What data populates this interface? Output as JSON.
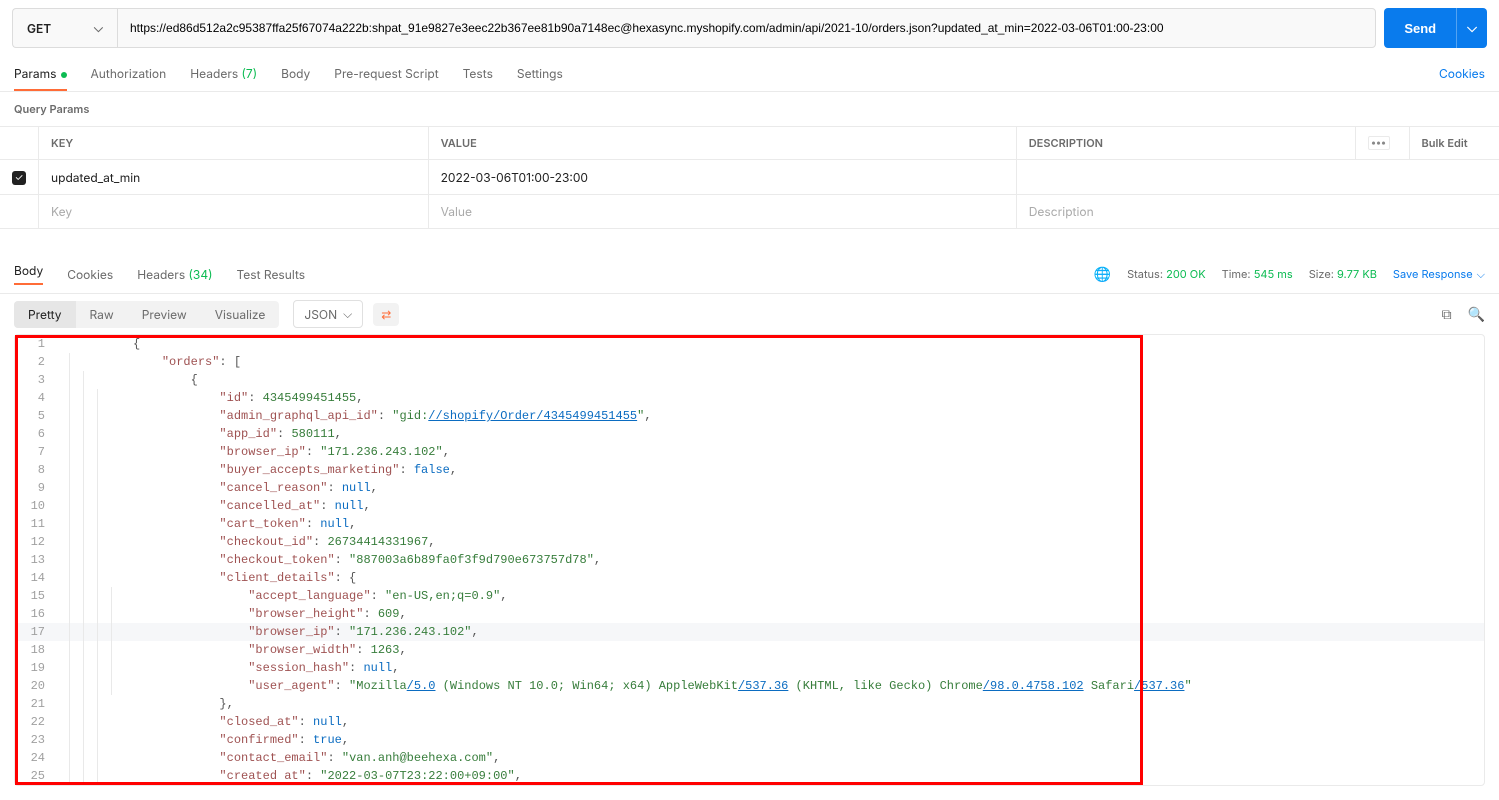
{
  "request": {
    "method": "GET",
    "url": "https://ed86d512a2c95387ffa25f67074a222b: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@hexasync.myshopify.com/admin/api/2021-10/orders.json?updated_at_min=2022-03-06T01:00-23:00",
    "send_label": "Send"
  },
  "req_tabs": {
    "params": "Params",
    "auth": "Authorization",
    "headers": "Headers",
    "headers_count": "(7)",
    "body": "Body",
    "prerequest": "Pre-request Script",
    "tests": "Tests",
    "settings": "Settings",
    "cookies": "Cookies"
  },
  "query_params": {
    "title": "Query Params",
    "headers": {
      "key": "KEY",
      "value": "VALUE",
      "description": "DESCRIPTION",
      "bulk": "Bulk Edit"
    },
    "row1": {
      "key": "updated_at_min",
      "value": "2022-03-06T01:00-23:00"
    },
    "row2": {
      "key_ph": "Key",
      "value_ph": "Value",
      "desc_ph": "Description"
    }
  },
  "resp_tabs": {
    "body": "Body",
    "cookies": "Cookies",
    "headers": "Headers",
    "headers_count": "(34)",
    "tests": "Test Results"
  },
  "status": {
    "status_lbl": "Status:",
    "status_val": "200 OK",
    "time_lbl": "Time:",
    "time_val": "545 ms",
    "size_lbl": "Size:",
    "size_val": "9.77 KB",
    "save": "Save Response"
  },
  "viewer": {
    "pretty": "Pretty",
    "raw": "Raw",
    "preview": "Preview",
    "visualize": "Visualize",
    "json": "JSON"
  },
  "json_body": {
    "id": "4345499451455",
    "admin_graphql_api_id_link": "//shopify/Order/4345499451455",
    "app_id": "580111",
    "browser_ip": "171.236.243.102",
    "buyer_accepts_marketing": "false",
    "cancel_reason": "null",
    "cancelled_at": "null",
    "cart_token": "null",
    "checkout_id": "26734414331967",
    "checkout_token": "887003a6b89fa0f3f9d790e673757d78",
    "accept_language": "en-US,en;q=0.9",
    "browser_height": "609",
    "client_browser_ip": "171.236.243.102",
    "browser_width": "1263",
    "session_hash": "null",
    "ua_p1": "Mozilla",
    "ua_l1": "/5.0",
    "ua_p2": " (Windows NT 10.0; Win64; x64) AppleWebKit",
    "ua_l2": "/537.36",
    "ua_p3": " (KHTML, like Gecko) Chrome",
    "ua_l3": "/98.0.4758.102",
    "ua_p4": " Safari",
    "ua_l4": "/537.36",
    "closed_at": "null",
    "confirmed": "true",
    "contact_email": "van.anh@beehexa.com",
    "created_at": "2022-03-07T23:22:00+09:00"
  }
}
